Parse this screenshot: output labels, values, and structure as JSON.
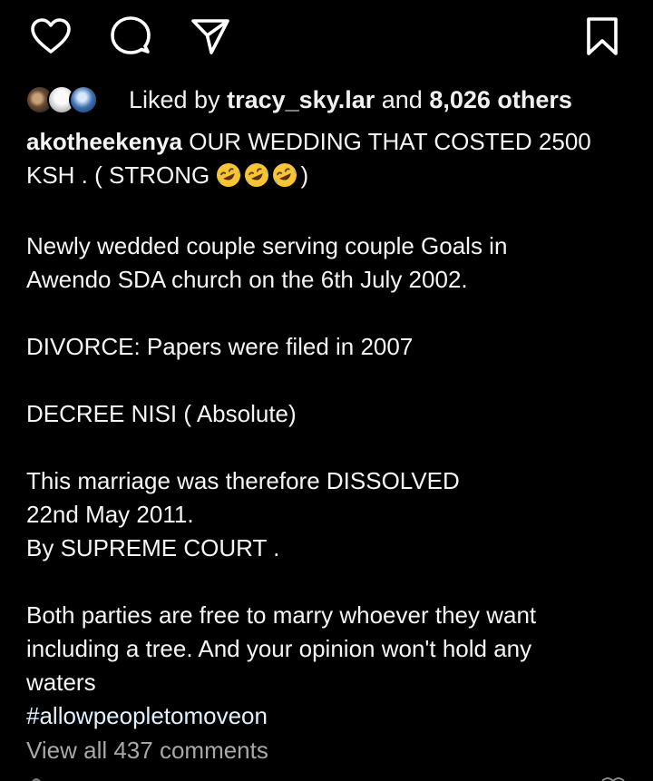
{
  "actions": {
    "like_icon": "heart-icon",
    "comment_icon": "comment-icon",
    "share_icon": "send-icon",
    "save_icon": "bookmark-icon"
  },
  "likes": {
    "prefix": "Liked by",
    "user": "tracy_sky.lar",
    "connector": "and",
    "others": "8,026 others"
  },
  "caption": {
    "username": "akotheekenya",
    "line1_rest": "OUR WEDDING THAT COSTED 2500",
    "line2_text": "KSH . ( STRONG",
    "line2_close": ")",
    "emoji_name": "rolling-on-floor-laughing-emoji",
    "para2_line1": "Newly wedded couple serving couple Goals in",
    "para2_line2": "Awendo SDA church on the 6th July 2002.",
    "para3": "DIVORCE: Papers were filed in 2007",
    "para4": "DECREE NISI ( Absolute)",
    "para5_line1": "This marriage was therefore DISSOLVED",
    "para5_line2": "22nd May 2011.",
    "para5_line3": "By SUPREME COURT .",
    "para6_line1": "Both parties are free to marry whoever they want",
    "para6_line2": "including a tree. And your opinion won't hold any",
    "para6_line3": "waters",
    "hashtag": "#allowpeopletomoveon"
  },
  "comments": {
    "view_all": "View all 437 comments"
  },
  "colors": {
    "background": "#000000",
    "text": "#f5f5f5",
    "muted": "#a8a8a8",
    "hashtag": "#e0f1ff"
  }
}
